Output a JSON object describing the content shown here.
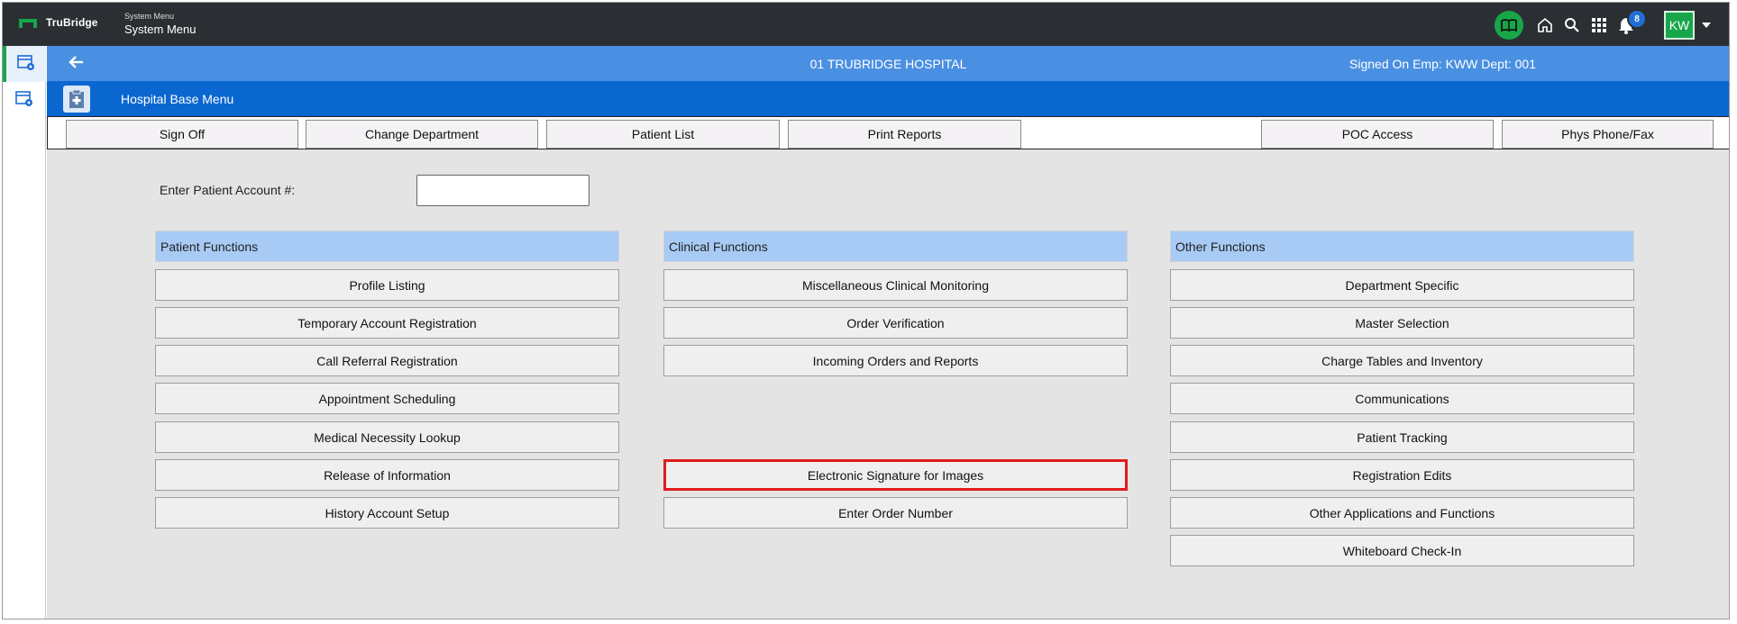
{
  "topbar": {
    "brand": "TruBridge",
    "crumb_small": "System Menu",
    "crumb_big": "System Menu",
    "notification_count": "8",
    "avatar_initials": "KW"
  },
  "header": {
    "hospital": "01 TRUBRIDGE HOSPITAL",
    "signed_on": "Signed On Emp: KWW Dept: 001",
    "menu_title": "Hospital Base Menu"
  },
  "actions": [
    {
      "label": "Sign Off"
    },
    {
      "label": "Change Department"
    },
    {
      "label": "Patient List"
    },
    {
      "label": "Print Reports"
    },
    {
      "label": "POC Access"
    },
    {
      "label": "Phys Phone/Fax"
    }
  ],
  "account": {
    "label": "Enter Patient Account #:",
    "value": ""
  },
  "columns": [
    {
      "title": "Patient Functions",
      "items": [
        "Profile Listing",
        "Temporary Account Registration",
        "Call Referral Registration",
        "Appointment Scheduling",
        "Medical Necessity Lookup",
        "Release of Information",
        "History Account Setup"
      ]
    },
    {
      "title": "Clinical Functions",
      "items": [
        "Miscellaneous Clinical Monitoring",
        "Order Verification",
        "Incoming Orders and Reports",
        "",
        "",
        "Electronic Signature for Images",
        "Enter Order Number"
      ]
    },
    {
      "title": "Other Functions",
      "items": [
        "Department Specific",
        "Master Selection",
        "Charge Tables and Inventory",
        "Communications",
        "Patient Tracking",
        "Registration Edits",
        "Other Applications and Functions",
        "Whiteboard Check-In"
      ]
    }
  ],
  "colors": {
    "topbar": "#2b2f33",
    "header_light": "#4a90e2",
    "header_dark": "#0b67d0",
    "accent_green": "#17a64a",
    "column_head": "#a8cbf5",
    "selected_border": "#e01b1b"
  }
}
